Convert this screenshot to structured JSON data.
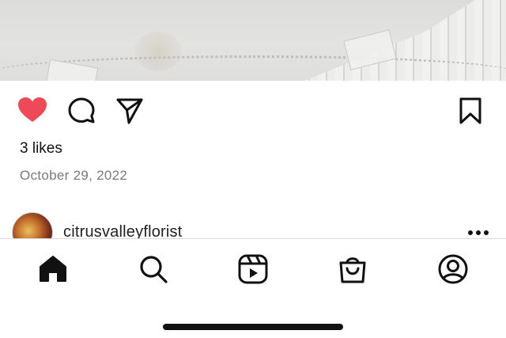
{
  "post": {
    "likes_text": "3 likes",
    "date_text": "October 29, 2022",
    "liked": true
  },
  "comment": {
    "username": "citrusvalleyflorist",
    "more_glyph": "•••"
  },
  "icons": {
    "like": "heart-icon",
    "comment": "comment-bubble-icon",
    "share": "paper-plane-icon",
    "save": "bookmark-icon",
    "home": "home-icon",
    "search": "search-icon",
    "reels": "reels-icon",
    "shop": "shopping-bag-icon",
    "profile": "profile-icon"
  },
  "colors": {
    "like_red": "#ed4956",
    "text": "#111111",
    "muted": "#7a7a7a"
  }
}
